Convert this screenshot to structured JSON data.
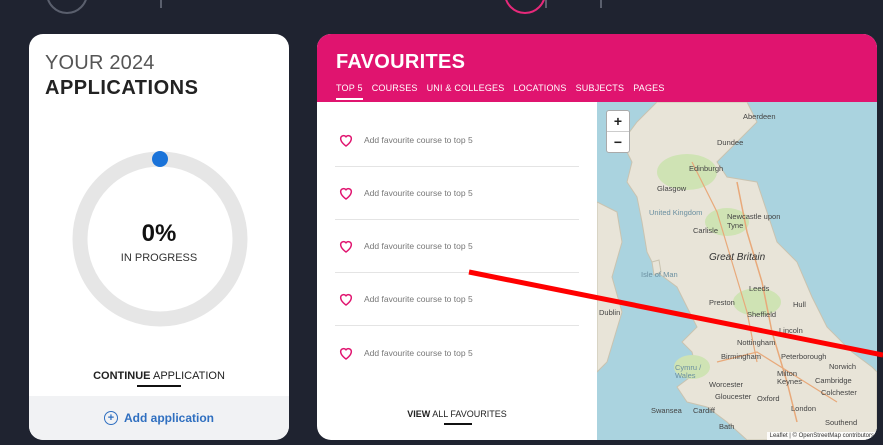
{
  "applications": {
    "title_line1": "YOUR 2024",
    "title_line2": "APPLICATIONS",
    "progress_percent": 0,
    "progress_text": "0%",
    "status": "IN PROGRESS",
    "continue_bold": "CONTINUE",
    "continue_rest": " APPLICATION",
    "add_label": "Add application"
  },
  "favourites": {
    "title": "FAVOURITES",
    "tabs": [
      "TOP 5",
      "COURSES",
      "UNI & COLLEGES",
      "LOCATIONS",
      "SUBJECTS",
      "PAGES"
    ],
    "active_tab": "TOP 5",
    "items": [
      "Add favourite course to top 5",
      "Add favourite course to top 5",
      "Add favourite course to top 5",
      "Add favourite course to top 5",
      "Add favourite course to top 5"
    ],
    "view_all_bold": "VIEW",
    "view_all_rest": " ALL FAVOURITES"
  },
  "map": {
    "zoom_in": "+",
    "zoom_out": "−",
    "labels": {
      "aberdeen": "Aberdeen",
      "dundee": "Dundee",
      "edinburgh": "Edinburgh",
      "glasgow": "Glasgow",
      "united_kingdom": "United Kingdom",
      "newcastle": "Newcastle upon Tyne",
      "carlisle": "Carlisle",
      "great_britain": "Great Britain",
      "isle_of_man": "Isle of Man",
      "leeds": "Leeds",
      "preston": "Preston",
      "hull": "Hull",
      "dublin": "Dublin",
      "sheffield": "Sheffield",
      "lincoln": "Lincoln",
      "nottingham": "Nottingham",
      "birmingham": "Birmingham",
      "peterborough": "Peterborough",
      "norwich": "Norwich",
      "cymru": "Cymru / Wales",
      "milton_keynes": "Milton Keynes",
      "worcester": "Worcester",
      "cambridge": "Cambridge",
      "colchester": "Colchester",
      "gloucester": "Gloucester",
      "oxford": "Oxford",
      "swansea": "Swansea",
      "cardiff": "Cardiff",
      "london": "London",
      "southend": "Southend",
      "bath": "Bath"
    },
    "attribution": "Leaflet | © OpenStreetMap contributors"
  },
  "colors": {
    "brand_pink": "#e0146f",
    "progress_blue": "#1a73d9",
    "link_blue": "#2f6fc0",
    "background": "#1f2330",
    "annotation_red": "#ff0000"
  }
}
